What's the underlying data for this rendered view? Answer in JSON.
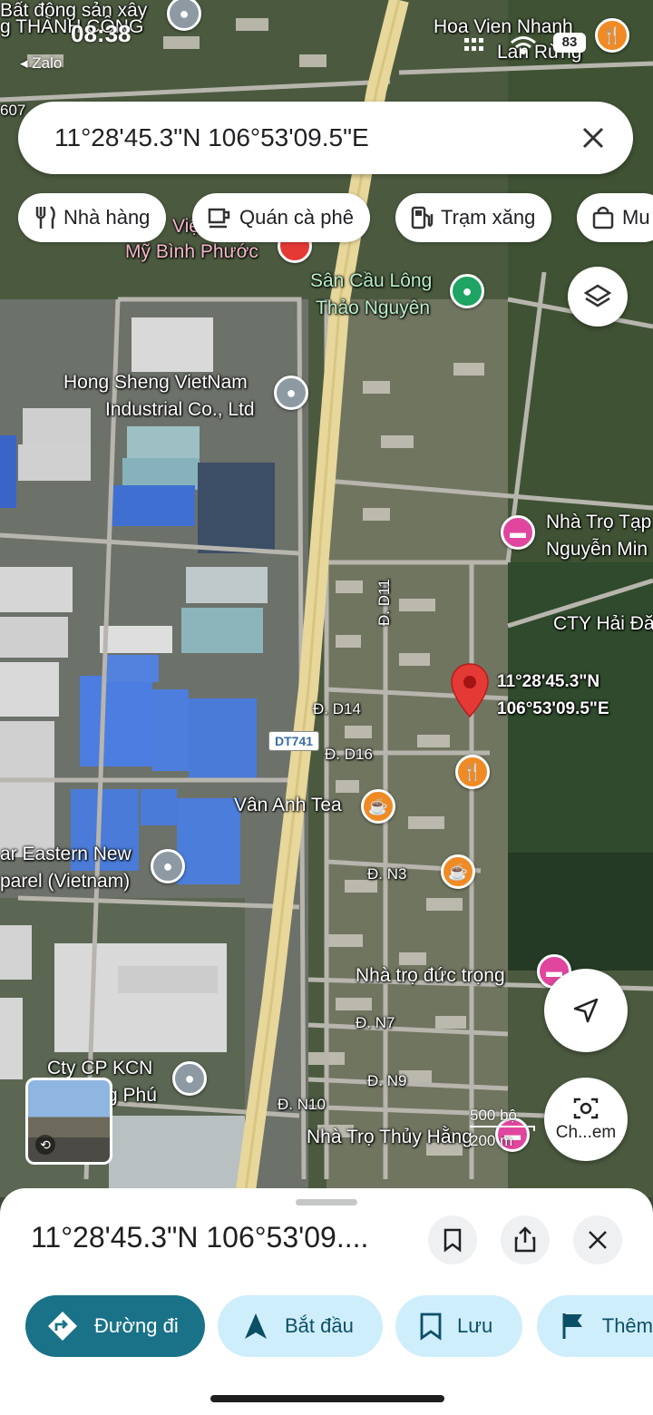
{
  "status_bar": {
    "time": "08:38",
    "back_app": "◂ Zalo",
    "battery": "83"
  },
  "search": {
    "query": "11°28'45.3\"N 106°53'09.5\"E"
  },
  "chips": [
    {
      "label": "Nhà hàng",
      "icon": "restaurant-icon"
    },
    {
      "label": "Quán cà phê",
      "icon": "coffee-icon"
    },
    {
      "label": "Trạm xăng",
      "icon": "gas-station-icon"
    },
    {
      "label": "Mu",
      "icon": "shopping-bag-icon"
    }
  ],
  "map_labels": {
    "top_left": "g THÀNH CÔNG",
    "top_left_partial": "Bất động sản xây",
    "hoa_vien": "Hoa Vien Nhanh",
    "lan_rung": "Lan Rừng",
    "road_607": "607",
    "viet_my_1": "Việ",
    "viet_my_2": "Mỹ Bình Phước",
    "san_cau_long_1": "Sân Cầu Lông",
    "san_cau_long_2": "Thảo Nguyên",
    "hong_sheng_1": "Hong Sheng VietNam",
    "hong_sheng_2": "Industrial Co., Ltd",
    "nha_tro_tap_1": "Nhà Trọ Tạp",
    "nha_tro_tap_2": "Nguyễn Min",
    "cty_hai": "CTY Hải Đă",
    "road_d11": "Đ. D11",
    "pin_coord_1": "11°28'45.3\"N",
    "pin_coord_2": "106°53'09.5\"E",
    "road_d14": "Đ. D14",
    "road_d16": "Đ. D16",
    "dt741": "DT741",
    "van_anh": "Vân Anh Tea",
    "far_eastern_1": "ar Eastern New",
    "far_eastern_2": "parel (Vietnam)",
    "road_n3": "Đ. N3",
    "nha_tro_duc": "Nhà trọ đức trọng",
    "road_n7": "Đ. N7",
    "road_n9": "Đ. N9",
    "road_n10": "Đ. N10",
    "cty_cp_1": "Cty CP KCN",
    "cty_cp_2": "g Phú",
    "nha_tro_thuy": "Nhà Trọ Thủy Hằng"
  },
  "scale": {
    "top": "500 bộ",
    "bottom": "200 m"
  },
  "lens_label": "Ch...em",
  "sheet": {
    "title": "11°28'45.3\"N 106°53'09....",
    "actions": [
      {
        "label": "Đường đi",
        "icon": "directions-icon"
      },
      {
        "label": "Bắt đầu",
        "icon": "navigation-icon"
      },
      {
        "label": "Lưu",
        "icon": "bookmark-icon"
      },
      {
        "label": "Thêm",
        "icon": "flag-icon"
      }
    ]
  }
}
